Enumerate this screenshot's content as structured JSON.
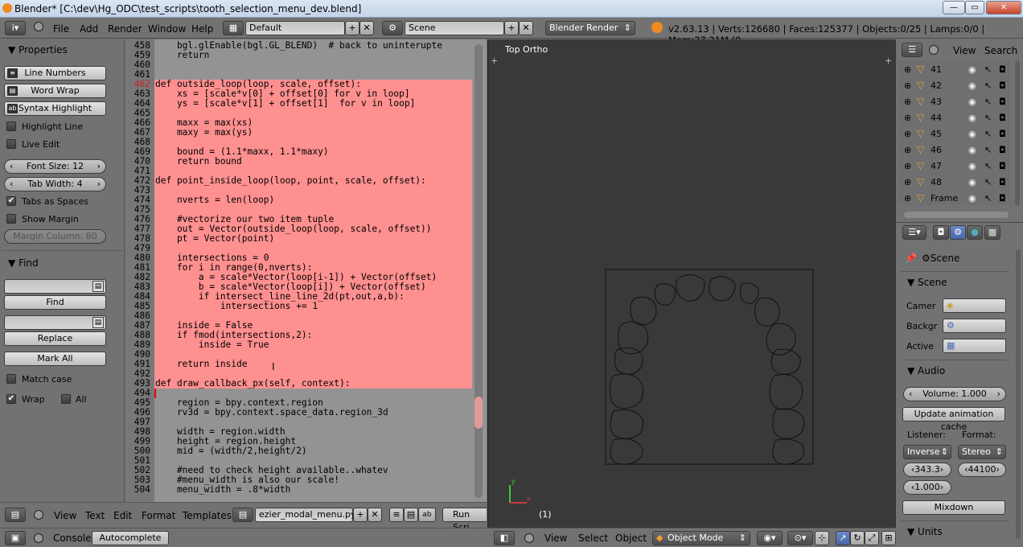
{
  "window": {
    "title": "Blender* [C:\\dev\\Hg_ODC\\test_scripts\\tooth_selection_menu_dev.blend]",
    "min": "—",
    "max": "▭",
    "close": "✕"
  },
  "topbar": {
    "menus": [
      "File",
      "Add",
      "Render",
      "Window",
      "Help"
    ],
    "layout": "Default",
    "scene": "Scene",
    "engine": "Blender Render",
    "stats": "v2.63.13 | Verts:126680 | Faces:125377 | Objects:0/25 | Lamps:0/0 | Mem:37.21M (0"
  },
  "properties_panel": {
    "title": "Properties",
    "line_numbers": "Line Numbers",
    "word_wrap": "Word Wrap",
    "syntax_highlight": "Syntax Highlight",
    "highlight_line": "Highlight Line",
    "live_edit": "Live Edit",
    "font_size": "Font Size: 12",
    "tab_width": "Tab Width: 4",
    "tabs_as_spaces": "Tabs as Spaces",
    "show_margin": "Show Margin",
    "margin_column": "Margin Column: 80",
    "find_title": "Find",
    "find_btn": "Find",
    "replace_btn": "Replace",
    "mark_all_btn": "Mark All",
    "match_case": "Match case",
    "wrap": "Wrap",
    "all": "All"
  },
  "code_lines": [
    {
      "n": "458",
      "t": "    bgl.glEnable(bgl.GL_BLEND)  # back to uninterupte"
    },
    {
      "n": "459",
      "t": "    return"
    },
    {
      "n": "460",
      "t": ""
    },
    {
      "n": "461",
      "t": ""
    },
    {
      "n": "462",
      "t": "def outside_loop(loop, scale, offset):"
    },
    {
      "n": "463",
      "t": "    xs = [scale*v[0] + offset[0] for v in loop]"
    },
    {
      "n": "464",
      "t": "    ys = [scale*v[1] + offset[1]  for v in loop]"
    },
    {
      "n": "465",
      "t": ""
    },
    {
      "n": "466",
      "t": "    maxx = max(xs)"
    },
    {
      "n": "467",
      "t": "    maxy = max(ys)"
    },
    {
      "n": "468",
      "t": ""
    },
    {
      "n": "469",
      "t": "    bound = (1.1*maxx, 1.1*maxy)"
    },
    {
      "n": "470",
      "t": "    return bound"
    },
    {
      "n": "471",
      "t": ""
    },
    {
      "n": "472",
      "t": "def point_inside_loop(loop, point, scale, offset):"
    },
    {
      "n": "473",
      "t": ""
    },
    {
      "n": "474",
      "t": "    nverts = len(loop)"
    },
    {
      "n": "475",
      "t": ""
    },
    {
      "n": "476",
      "t": "    #vectorize our two item tuple"
    },
    {
      "n": "477",
      "t": "    out = Vector(outside_loop(loop, scale, offset))"
    },
    {
      "n": "478",
      "t": "    pt = Vector(point)"
    },
    {
      "n": "479",
      "t": ""
    },
    {
      "n": "480",
      "t": "    intersections = 0"
    },
    {
      "n": "481",
      "t": "    for i in range(0,nverts):"
    },
    {
      "n": "482",
      "t": "        a = scale*Vector(loop[i-1]) + Vector(offset)"
    },
    {
      "n": "483",
      "t": "        b = scale*Vector(loop[i]) + Vector(offset)"
    },
    {
      "n": "484",
      "t": "        if intersect_line_line_2d(pt,out,a,b):"
    },
    {
      "n": "485",
      "t": "            intersections += 1"
    },
    {
      "n": "486",
      "t": ""
    },
    {
      "n": "487",
      "t": "    inside = False"
    },
    {
      "n": "488",
      "t": "    if fmod(intersections,2):"
    },
    {
      "n": "489",
      "t": "        inside = True"
    },
    {
      "n": "490",
      "t": ""
    },
    {
      "n": "491",
      "t": "    return inside"
    },
    {
      "n": "492",
      "t": ""
    },
    {
      "n": "493",
      "t": "def draw_callback_px(self, context):"
    },
    {
      "n": "494",
      "t": ""
    },
    {
      "n": "495",
      "t": "    region = bpy.context.region"
    },
    {
      "n": "496",
      "t": "    rv3d = bpy.context.space_data.region_3d"
    },
    {
      "n": "497",
      "t": ""
    },
    {
      "n": "498",
      "t": "    width = region.width"
    },
    {
      "n": "499",
      "t": "    height = region.height"
    },
    {
      "n": "500",
      "t": "    mid = (width/2,height/2)"
    },
    {
      "n": "501",
      "t": ""
    },
    {
      "n": "502",
      "t": "    #need to check height available..whatev"
    },
    {
      "n": "503",
      "t": "    #menu_width is also our scale!"
    },
    {
      "n": "504",
      "t": "    menu_width = .8*width"
    }
  ],
  "text_header": {
    "menus": [
      "View",
      "Text",
      "Edit",
      "Format",
      "Templates"
    ],
    "filename": "ezier_modal_menu.py",
    "run_script": "Run Scri"
  },
  "console_bar": {
    "console": "Console",
    "autocomplete": "Autocomplete"
  },
  "viewport": {
    "label": "Top Ortho",
    "frame": "(1)",
    "menus": [
      "View",
      "Select",
      "Object"
    ],
    "mode": "Object Mode"
  },
  "outliner": {
    "view": "View",
    "search": "Search",
    "items": [
      "41",
      "42",
      "43",
      "44",
      "45",
      "46",
      "47",
      "48",
      "Frame"
    ]
  },
  "props_right": {
    "scene_label": "Scene",
    "scene_section": "Scene",
    "camera": "Camer",
    "background": "Backgr",
    "active": "Active",
    "audio_section": "Audio",
    "volume": "Volume: 1.000",
    "update_cache": "Update animation cache",
    "listener": "Listener:",
    "format": "Format:",
    "listener_value": "Inverse",
    "format_value": "Stereo",
    "speed": "343.3",
    "rate": "44100",
    "doppler": "1.000",
    "mixdown": "Mixdown",
    "units_section": "Units"
  }
}
